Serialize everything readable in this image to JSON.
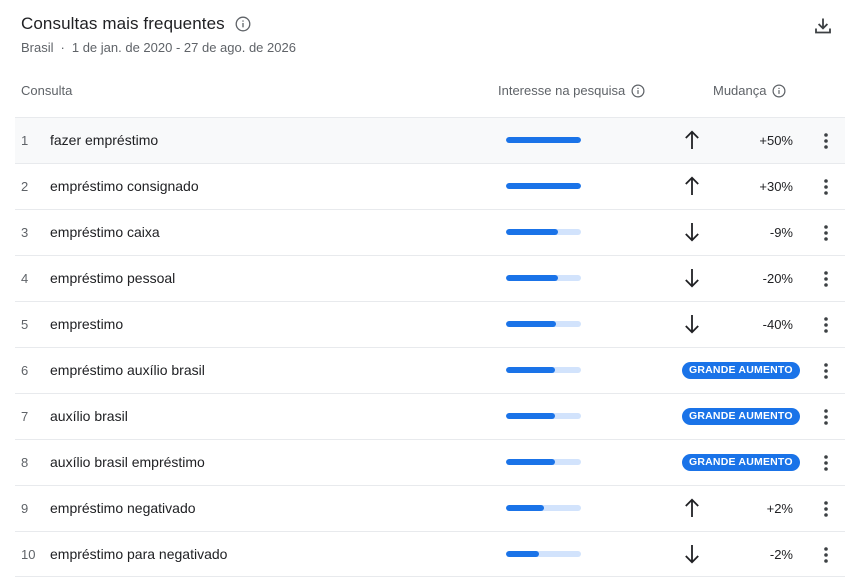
{
  "header": {
    "title": "Consultas mais frequentes",
    "region": "Brasil",
    "separator": "·",
    "date_range": "1 de jan. de 2020 - 27 de ago. de 2026"
  },
  "columns": {
    "query": "Consulta",
    "interest": "Interesse na pesquisa",
    "change": "Mudança"
  },
  "colors": {
    "accent": "#1a73e8",
    "track": "#d2e3fc"
  },
  "rows": [
    {
      "rank": "1",
      "query": "fazer empréstimo",
      "interest": 1.0,
      "direction": "up",
      "change": "+50%"
    },
    {
      "rank": "2",
      "query": "empréstimo consignado",
      "interest": 1.0,
      "direction": "up",
      "change": "+30%"
    },
    {
      "rank": "3",
      "query": "empréstimo caixa",
      "interest": 0.69,
      "direction": "down",
      "change": "-9%"
    },
    {
      "rank": "4",
      "query": "empréstimo pessoal",
      "interest": 0.69,
      "direction": "down",
      "change": "-20%"
    },
    {
      "rank": "5",
      "query": "emprestimo",
      "interest": 0.67,
      "direction": "down",
      "change": "-40%"
    },
    {
      "rank": "6",
      "query": "empréstimo auxílio brasil",
      "interest": 0.65,
      "direction": "badge",
      "change": "GRANDE AUMENTO"
    },
    {
      "rank": "7",
      "query": "auxílio brasil",
      "interest": 0.65,
      "direction": "badge",
      "change": "GRANDE AUMENTO"
    },
    {
      "rank": "8",
      "query": "auxílio brasil empréstimo",
      "interest": 0.65,
      "direction": "badge",
      "change": "GRANDE AUMENTO"
    },
    {
      "rank": "9",
      "query": "empréstimo negativado",
      "interest": 0.51,
      "direction": "up",
      "change": "+2%"
    },
    {
      "rank": "10",
      "query": "empréstimo para negativado",
      "interest": 0.44,
      "direction": "down",
      "change": "-2%"
    }
  ]
}
